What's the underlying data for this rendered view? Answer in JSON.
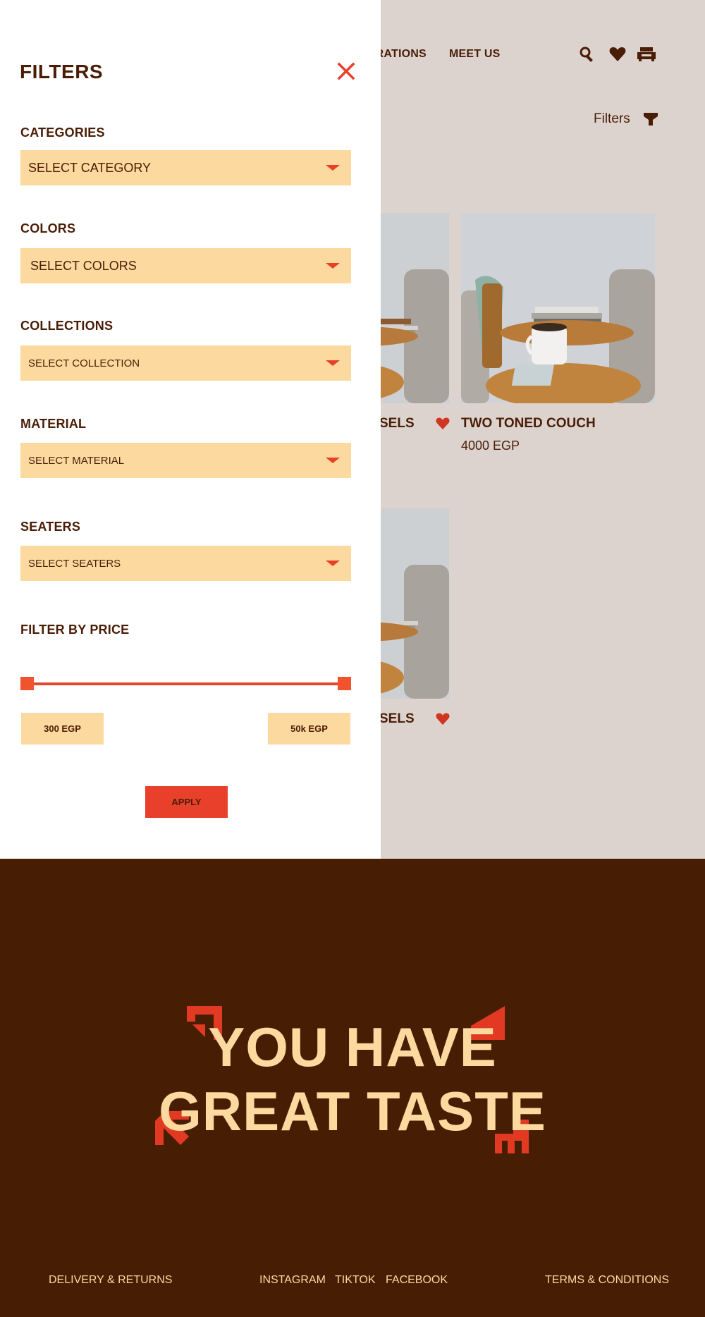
{
  "nav": {
    "links": [
      "ORATIONS",
      "MEET US"
    ],
    "icons": [
      "search-icon",
      "heart-icon",
      "cart-icon"
    ]
  },
  "toolbar": {
    "filters_label": "Filters",
    "filters_icon": "funnel-icon"
  },
  "products": [
    {
      "name": "SELS",
      "price": ""
    },
    {
      "name": "TWO TONED COUCH",
      "price": "4000 EGP"
    },
    {
      "name": "SELS",
      "price": ""
    }
  ],
  "drawer": {
    "title": "FILTERS",
    "close_icon": "close-icon",
    "sections": [
      {
        "label": "CATEGORIES",
        "value": "SELECT CATEGORY"
      },
      {
        "label": "COLORS",
        "value": "SELECT COLORS"
      },
      {
        "label": "COLLECTIONS",
        "value": "SELECT COLLECTION"
      },
      {
        "label": "MATERIAL",
        "value": "SELECT MATERIAL"
      },
      {
        "label": "SEATERS",
        "value": "SELECT SEATERS"
      }
    ],
    "price": {
      "label": "FILTER BY PRICE",
      "min_label": "300 EGP",
      "max_label": "50k EGP",
      "range_fraction": [
        0,
        1
      ]
    },
    "apply_label": "APPLY"
  },
  "footer": {
    "tagline_line1": "YOU HAVE",
    "tagline_line2": "GREAT TASTE",
    "links": [
      "DELIVERY & RETURNS",
      "INSTAGRAM",
      "TIKTOK",
      "FACEBOOK",
      "TERMS & CONDITIONS"
    ]
  },
  "colors": {
    "brown": "#4a1d06",
    "cream": "#fcd99e",
    "accent": "#e8402a",
    "page_bg": "#ddd3ce",
    "footer_bg": "#471e04"
  }
}
